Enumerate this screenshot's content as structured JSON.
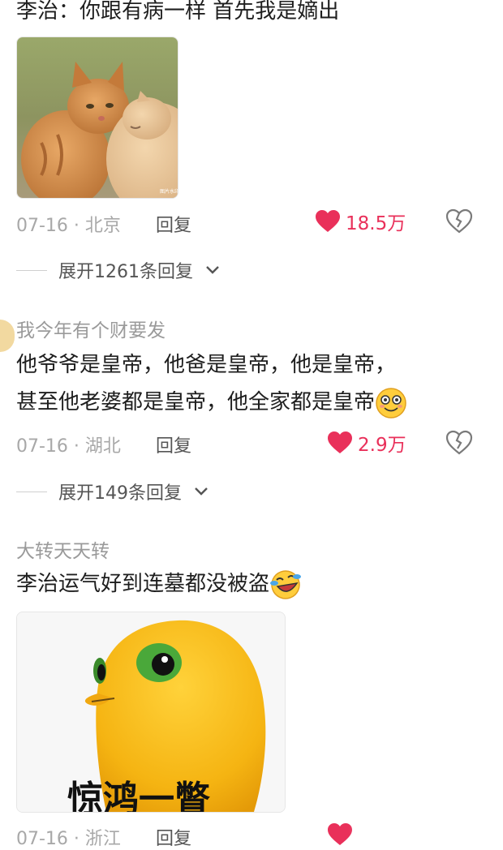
{
  "comments": [
    {
      "text": "李治：你跟有病一样 首先我是嫡出",
      "meta": "07-16 · 北京",
      "reply_label": "回复",
      "likes": "18.5万",
      "expand_label": "展开1261条回复",
      "image": "orange cats photo"
    },
    {
      "username": "我今年有个财要发",
      "text_line1": "他爷爷是皇帝，他爸是皇帝，他是皇帝，",
      "text_line2": "甚至他老婆都是皇帝，他全家都是皇帝",
      "meta": "07-16 · 湖北",
      "reply_label": "回复",
      "likes": "2.9万",
      "expand_label": "展开149条回复"
    },
    {
      "username": "大转天天转",
      "text": "李治运气好到连墓都没被盗",
      "image_caption": "惊鸿一瞥",
      "meta": "07-16 · 浙江",
      "reply_label": "回复"
    }
  ],
  "colors": {
    "like": "#e9305a",
    "meta": "#a8a8a8",
    "text": "#1e1e1e"
  },
  "icons": [
    "heart-icon",
    "broken-heart-icon",
    "chevron-down-icon",
    "smiley-emoji-icon",
    "laughing-emoji-icon"
  ]
}
